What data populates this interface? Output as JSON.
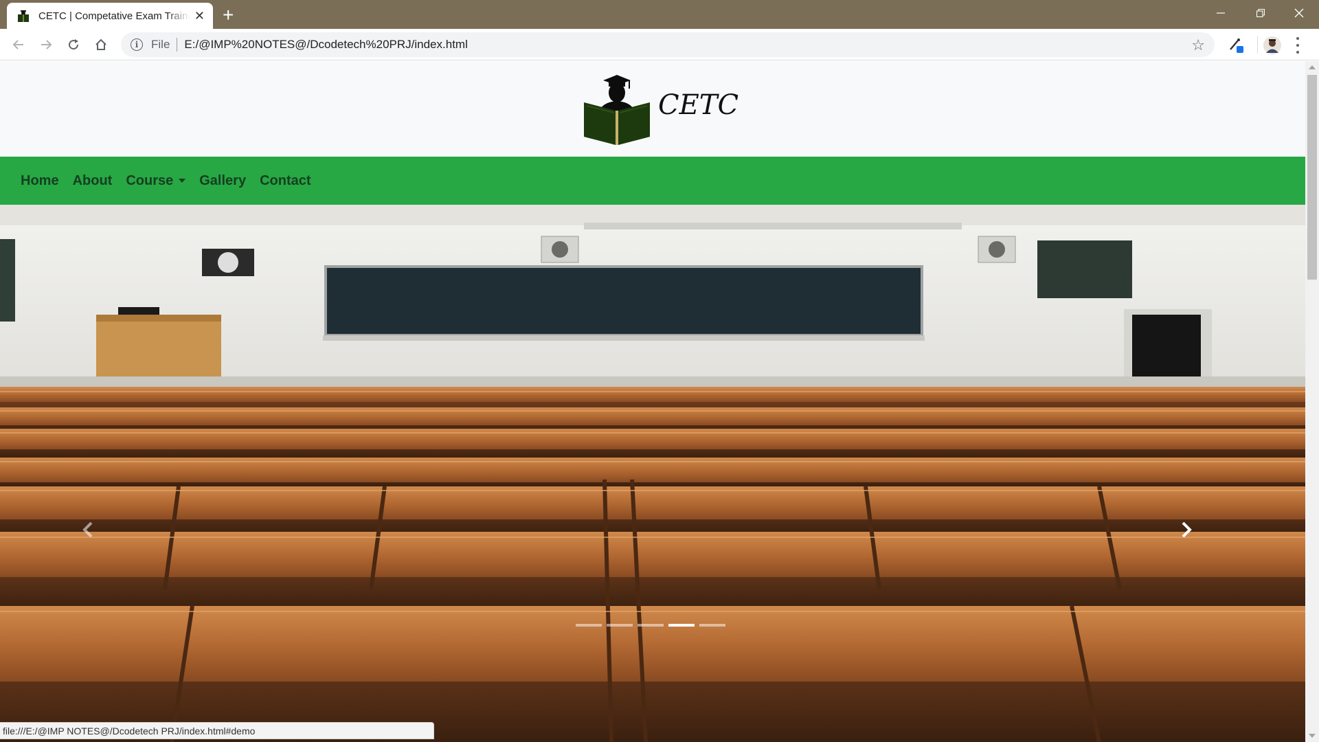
{
  "browser": {
    "tab_title": "CETC | Competative Exam Training",
    "omnibox": {
      "scheme_label": "File",
      "url": "E:/@IMP%20NOTES@/Dcodetech%20PRJ/index.html"
    },
    "status_url": "file:///E:/@IMP NOTES@/Dcodetech PRJ/index.html#demo"
  },
  "site": {
    "logo_text": "CETC",
    "nav": [
      {
        "label": "Home"
      },
      {
        "label": "About"
      },
      {
        "label": "Course",
        "dropdown": true
      },
      {
        "label": "Gallery"
      },
      {
        "label": "Contact"
      }
    ]
  },
  "carousel": {
    "slide_count": 5,
    "active_index": 3
  },
  "colors": {
    "navbar": "#28a745",
    "nav_text": "#14401f",
    "titlebar": "#7a6e57"
  }
}
